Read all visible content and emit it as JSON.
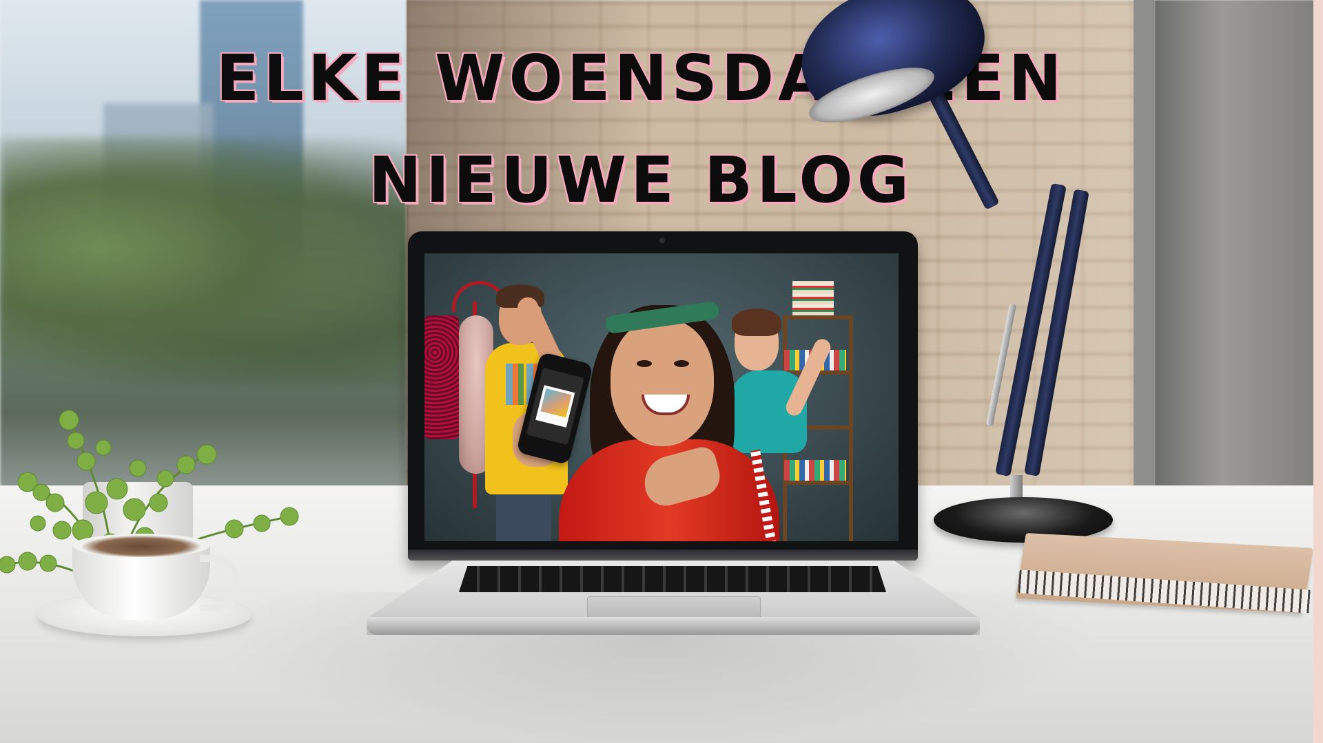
{
  "headline": {
    "line1": "ELKE WOENSDAG EEN",
    "line2": "NIEUWE BLOG"
  },
  "colors": {
    "headline_text": "#0c0c0c",
    "headline_outline": "#f5a9bd",
    "laptop_body": "#d3d3d3",
    "jacket": "#c21a14",
    "lamp": "#1b2340"
  },
  "scene": {
    "objects": [
      "plant",
      "coffee-cup",
      "laptop",
      "desk-lamp",
      "notebook",
      "brick-wall",
      "window"
    ],
    "laptop_screen": {
      "content": "photo",
      "people": 3,
      "props": [
        "phone",
        "polaroid",
        "coat-stand",
        "feather-boa",
        "shelf",
        "books"
      ]
    }
  }
}
